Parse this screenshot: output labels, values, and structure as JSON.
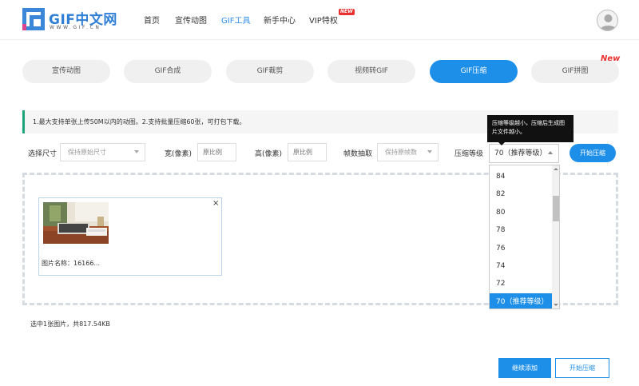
{
  "header": {
    "logo_text": "GIF中文网",
    "logo_sub": "WWW.GIF.CN",
    "nav": [
      {
        "label": "首页"
      },
      {
        "label": "宣传动图"
      },
      {
        "label": "GIF工具"
      },
      {
        "label": "新手中心"
      },
      {
        "label": "VIP特权"
      }
    ],
    "new_badge": "NEW",
    "accent": "#2f8ee8"
  },
  "tabs": [
    {
      "label": "宣传动图"
    },
    {
      "label": "GIF合成"
    },
    {
      "label": "GIF裁剪"
    },
    {
      "label": "视频转GIF"
    },
    {
      "label": "GIF压缩"
    },
    {
      "label": "GIF拼图"
    }
  ],
  "tab_new": "New",
  "notice": "1.最大支持单张上传50M以内的动图。2.支持批量压缩60张，可打包下载。",
  "options": {
    "size_label": "选择尺寸",
    "size_value": "保持原始尺寸",
    "width_label": "宽(像素)",
    "width_placeholder": "原比例",
    "height_label": "高(像素)",
    "height_placeholder": "原比例",
    "frame_label": "帧数抽取",
    "frame_value": "保持原帧数",
    "level_label": "压缩等级",
    "level_value": "70（推荐等级）",
    "start_label": "开始压缩"
  },
  "tooltip": "压缩等级越小，压缩后生成图片文件越小。",
  "dropdown": {
    "items": [
      "84",
      "82",
      "80",
      "78",
      "76",
      "74",
      "72",
      "70（推荐等级）"
    ],
    "selected_index": 7
  },
  "file": {
    "name": "图片名称：16166...",
    "close": "×"
  },
  "summary": "选中1张图片，共817.54KB",
  "footer": {
    "continue_label": "继续添加",
    "start_label": "开始压缩"
  }
}
